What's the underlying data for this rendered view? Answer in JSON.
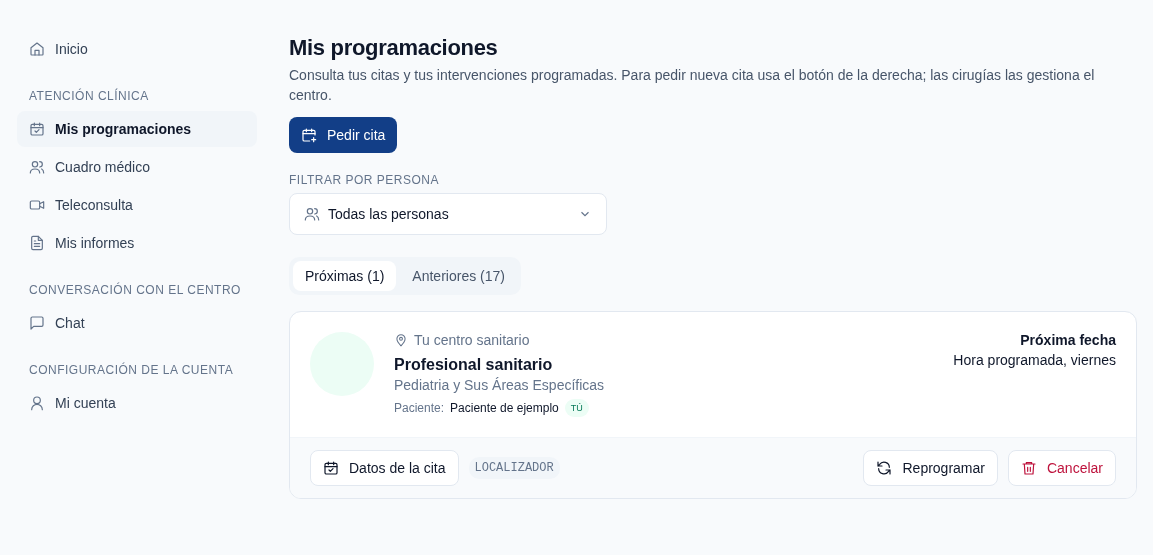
{
  "sidebar": {
    "groups": [
      {
        "items": [
          {
            "label": "Inicio",
            "selected": false
          }
        ]
      },
      {
        "heading": "ATENCIÓN CLÍNICA",
        "items": [
          {
            "label": "Mis programaciones",
            "selected": true
          },
          {
            "label": "Cuadro médico",
            "selected": false
          },
          {
            "label": "Teleconsulta",
            "selected": false
          },
          {
            "label": "Mis informes",
            "selected": false
          }
        ]
      },
      {
        "heading": "CONVERSACIÓN CON EL CENTRO",
        "items": [
          {
            "label": "Chat",
            "selected": false
          }
        ]
      },
      {
        "heading": "CONFIGURACIÓN DE LA CUENTA",
        "items": [
          {
            "label": "Mi cuenta",
            "selected": false
          }
        ]
      }
    ]
  },
  "page": {
    "title": "Mis programaciones",
    "description": "Consulta tus citas y tus intervenciones programadas. Para pedir nueva cita usa el botón de la derecha; las cirugías las gestiona el centro.",
    "primary_button": "Pedir cita"
  },
  "filter": {
    "label": "FILTRAR POR PERSONA",
    "value": "Todas las personas"
  },
  "tabs": [
    {
      "label": "Próximas (1)",
      "selected": true
    },
    {
      "label": "Anteriores (17)",
      "selected": false
    }
  ],
  "appointment": {
    "location": "Tu centro sanitario",
    "professional": "Profesional sanitario",
    "specialty": "Pediatria y Sus Áreas Específicas",
    "patient_label": "Paciente:",
    "patient": "Paciente de ejemplo",
    "patient_badge": "TÚ",
    "date_label": "Próxima fecha",
    "date": "Hora programada, viernes",
    "details_button": "Datos de la cita",
    "locator": "LOCALIZADOR",
    "actions": [
      {
        "label": "Reprogramar",
        "kind": "secondary"
      },
      {
        "label": "Cancelar",
        "kind": "danger"
      }
    ]
  }
}
